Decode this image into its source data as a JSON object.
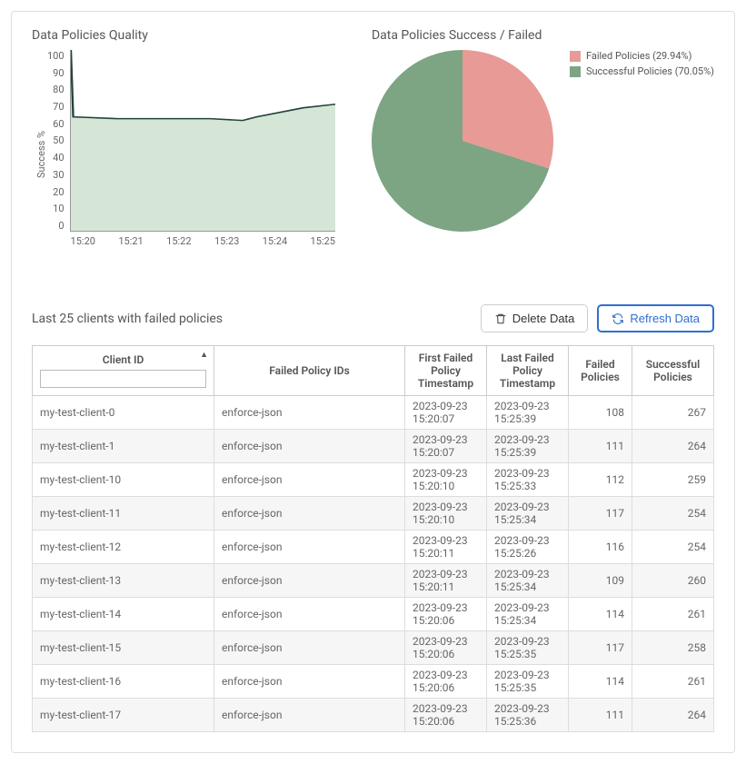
{
  "chart_data": [
    {
      "type": "line",
      "title": "Data Policies Quality",
      "ylabel": "Success %",
      "ylim": [
        0,
        100
      ],
      "yticks": [
        0,
        10,
        20,
        30,
        40,
        50,
        60,
        70,
        80,
        90,
        100
      ],
      "xticks": [
        "15:20",
        "15:21",
        "15:22",
        "15:23",
        "15:24",
        "15:25"
      ],
      "x": [
        0,
        0.05,
        1,
        2,
        3,
        3.7,
        4,
        5,
        5.7
      ],
      "values": [
        100,
        63,
        62,
        62,
        62,
        61,
        63,
        68,
        70
      ],
      "fill_color": "#d5e6d7",
      "line_color": "#23443a"
    },
    {
      "type": "pie",
      "title": "Data Policies Success / Failed",
      "series": [
        {
          "name": "Failed Policies",
          "value": 29.94,
          "color": "#e79a96",
          "legend": "Failed Policies (29.94%)"
        },
        {
          "name": "Successful Policies",
          "value": 70.05,
          "color": "#7da483",
          "legend": "Successful Policies (70.05%)"
        }
      ]
    }
  ],
  "table": {
    "title": "Last 25 clients with failed policies",
    "actions": {
      "delete_label": "Delete Data",
      "refresh_label": "Refresh Data"
    },
    "columns": {
      "client_id": "Client ID",
      "failed_ids": "Failed Policy IDs",
      "first_ts": "First Failed Policy Timestamp",
      "last_ts": "Last Failed Policy Timestamp",
      "failed": "Failed Policies",
      "success": "Successful Policies"
    },
    "filter_value": "",
    "rows": [
      {
        "client_id": "my-test-client-0",
        "failed_ids": "enforce-json",
        "first_ts": "2023-09-23 15:20:07",
        "last_ts": "2023-09-23 15:25:39",
        "failed": 108,
        "success": 267
      },
      {
        "client_id": "my-test-client-1",
        "failed_ids": "enforce-json",
        "first_ts": "2023-09-23 15:20:07",
        "last_ts": "2023-09-23 15:25:39",
        "failed": 111,
        "success": 264
      },
      {
        "client_id": "my-test-client-10",
        "failed_ids": "enforce-json",
        "first_ts": "2023-09-23 15:20:10",
        "last_ts": "2023-09-23 15:25:33",
        "failed": 112,
        "success": 259
      },
      {
        "client_id": "my-test-client-11",
        "failed_ids": "enforce-json",
        "first_ts": "2023-09-23 15:20:10",
        "last_ts": "2023-09-23 15:25:34",
        "failed": 117,
        "success": 254
      },
      {
        "client_id": "my-test-client-12",
        "failed_ids": "enforce-json",
        "first_ts": "2023-09-23 15:20:11",
        "last_ts": "2023-09-23 15:25:26",
        "failed": 116,
        "success": 254
      },
      {
        "client_id": "my-test-client-13",
        "failed_ids": "enforce-json",
        "first_ts": "2023-09-23 15:20:11",
        "last_ts": "2023-09-23 15:25:34",
        "failed": 109,
        "success": 260
      },
      {
        "client_id": "my-test-client-14",
        "failed_ids": "enforce-json",
        "first_ts": "2023-09-23 15:20:06",
        "last_ts": "2023-09-23 15:25:34",
        "failed": 114,
        "success": 261
      },
      {
        "client_id": "my-test-client-15",
        "failed_ids": "enforce-json",
        "first_ts": "2023-09-23 15:20:06",
        "last_ts": "2023-09-23 15:25:35",
        "failed": 117,
        "success": 258
      },
      {
        "client_id": "my-test-client-16",
        "failed_ids": "enforce-json",
        "first_ts": "2023-09-23 15:20:06",
        "last_ts": "2023-09-23 15:25:35",
        "failed": 114,
        "success": 261
      },
      {
        "client_id": "my-test-client-17",
        "failed_ids": "enforce-json",
        "first_ts": "2023-09-23 15:20:06",
        "last_ts": "2023-09-23 15:25:36",
        "failed": 111,
        "success": 264
      }
    ]
  }
}
